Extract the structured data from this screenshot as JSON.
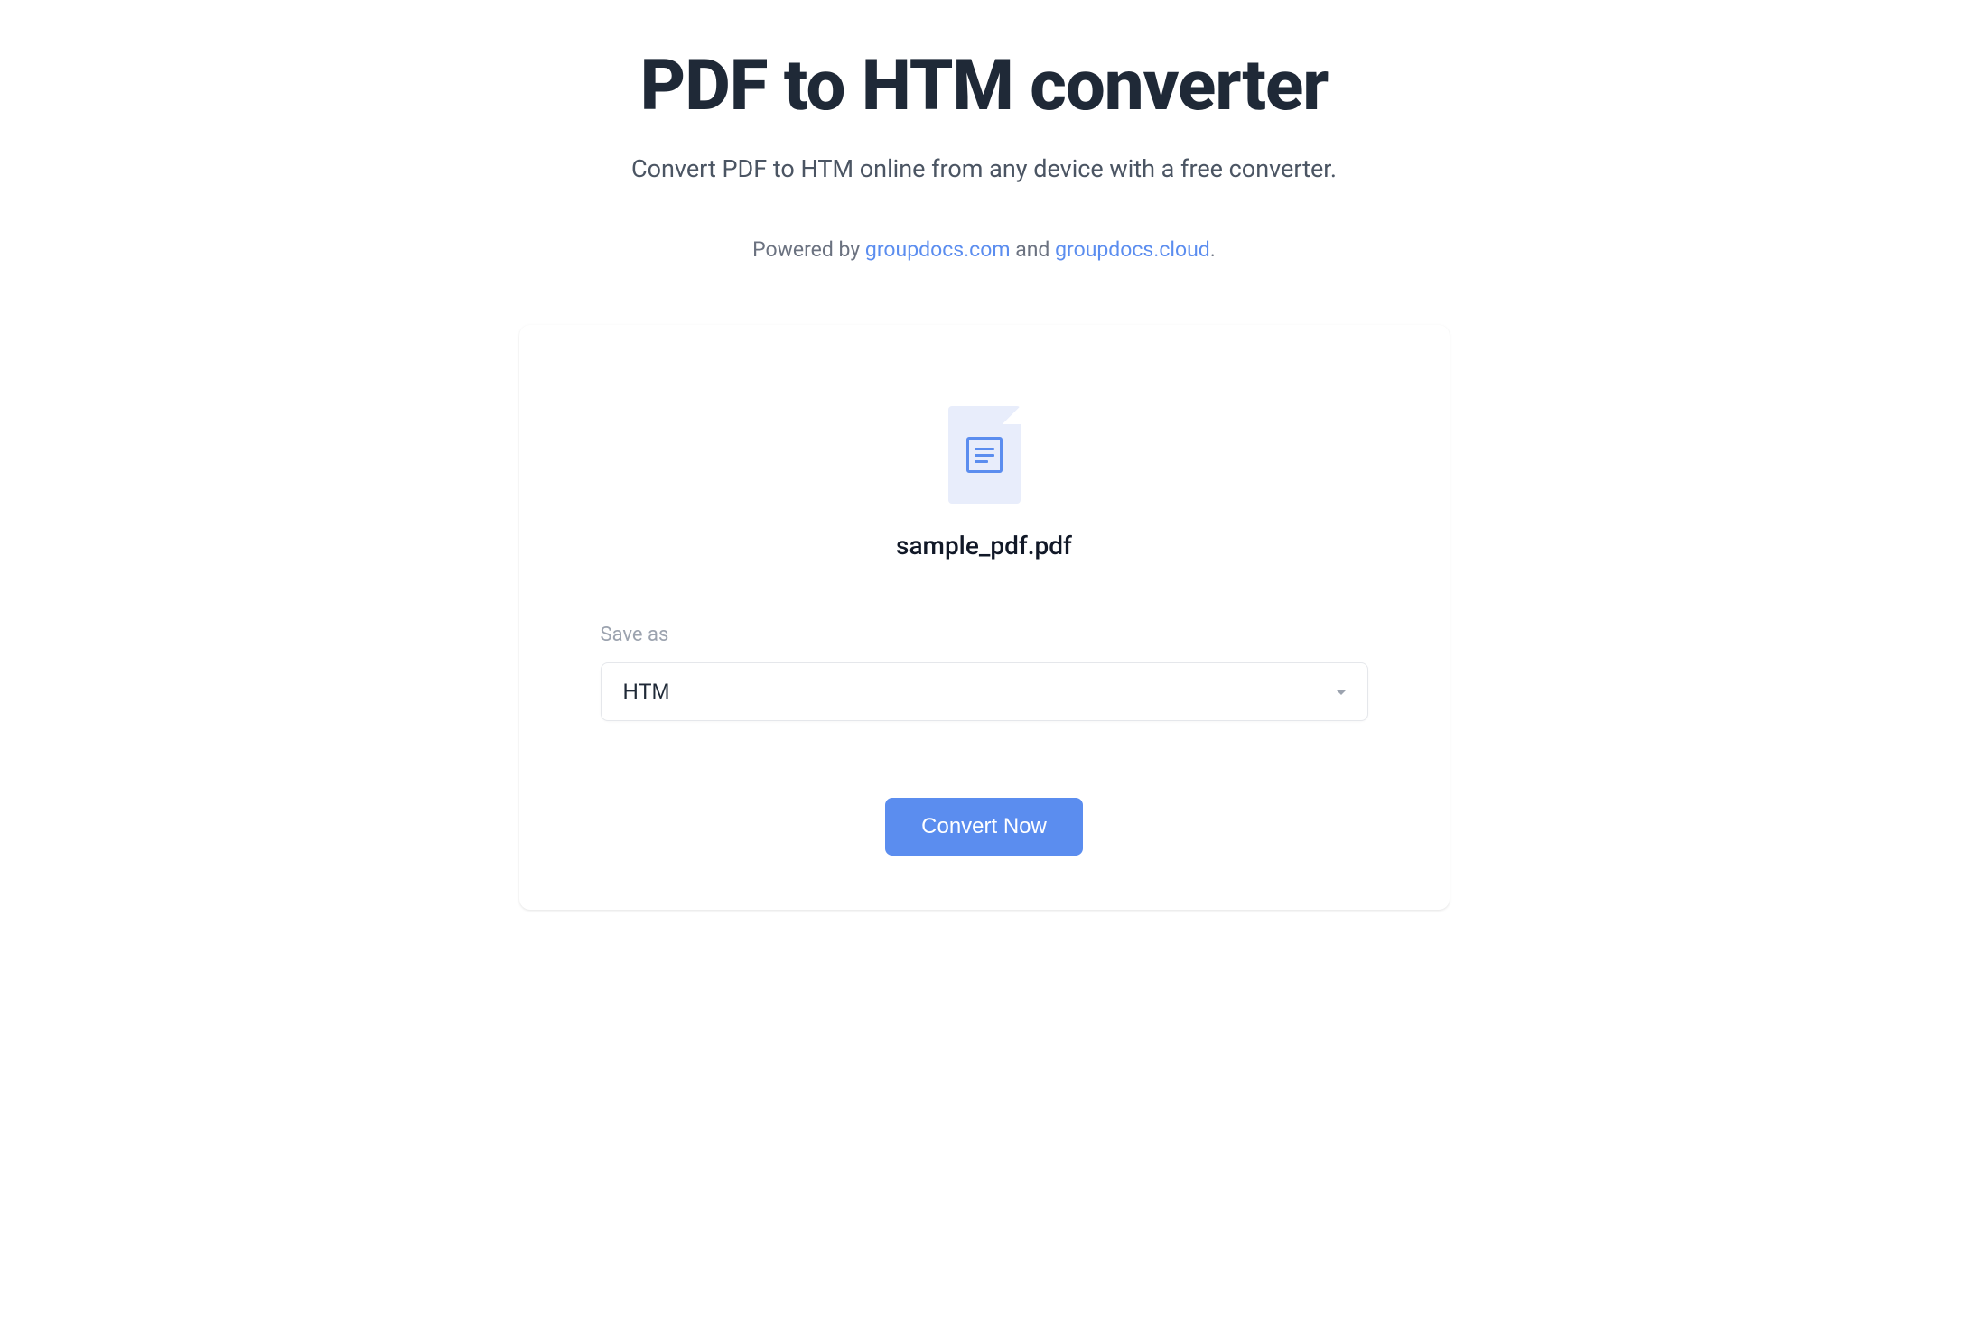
{
  "header": {
    "title": "PDF to HTM converter",
    "subtitle": "Convert PDF to HTM online from any device with a free converter.",
    "poweredBy": {
      "prefix": "Powered by ",
      "link1": "groupdocs.com",
      "separator": " and ",
      "link2": "groupdocs.cloud",
      "suffix": "."
    }
  },
  "file": {
    "name": "sample_pdf.pdf"
  },
  "form": {
    "saveAsLabel": "Save as",
    "selectedFormat": "HTM",
    "convertButton": "Convert Now"
  }
}
